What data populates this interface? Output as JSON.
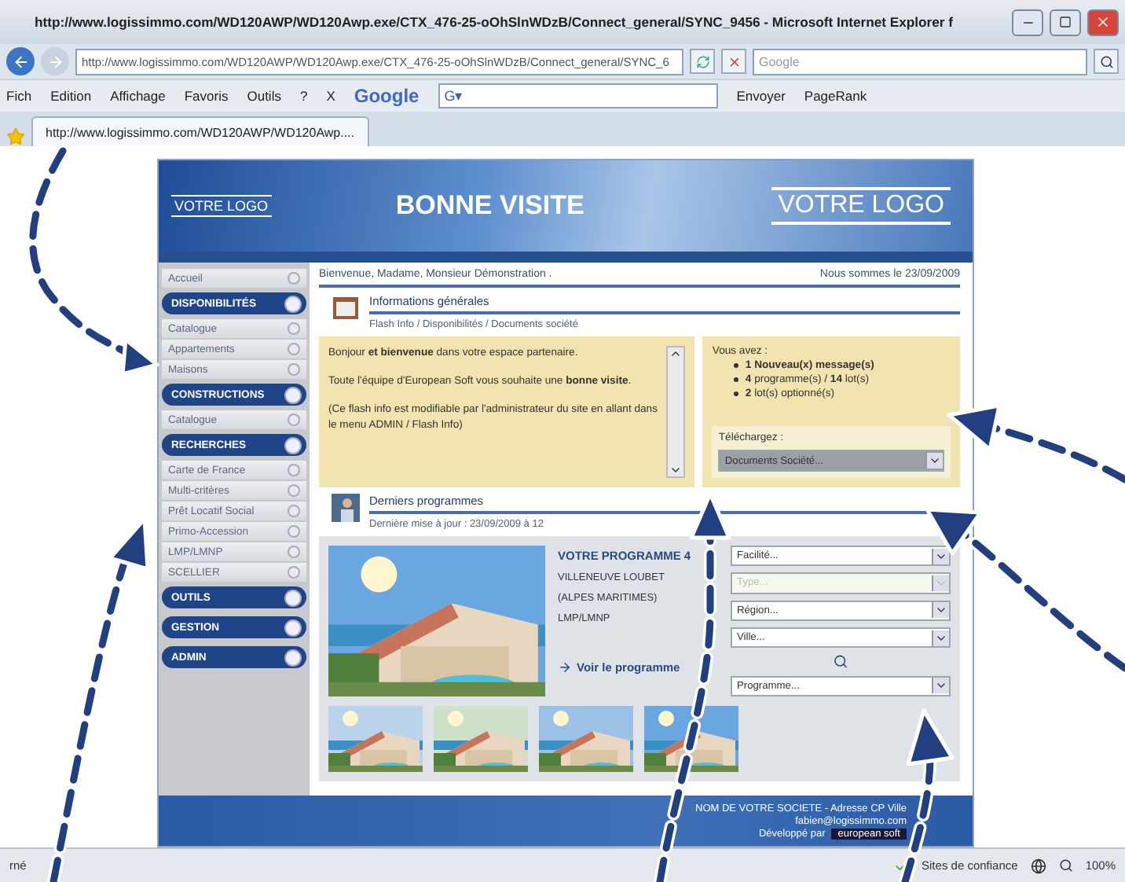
{
  "window": {
    "title": "http://www.logissimmo.com/WD120AWP/WD120Awp.exe/CTX_476-25-oOhSlnWDzB/Connect_general/SYNC_9456 - Microsoft Internet Explorer f"
  },
  "address_bar": {
    "value": "http://www.logissimmo.com/WD120AWP/WD120Awp.exe/CTX_476-25-oOhSlnWDzB/Connect_general/SYNC_6",
    "search_placeholder": "Google"
  },
  "menu": [
    "Fich",
    "Edition",
    "Affichage",
    "Favoris",
    "Outils",
    "?"
  ],
  "google_toolbar": {
    "close": "X",
    "logo": "Google",
    "field": "G▾",
    "send": "Envoyer",
    "pagerank": "PageRank"
  },
  "tabs": [
    {
      "label": "http://www.logissimmo.com/WD120AWP/WD120Awp....",
      "selected": true
    }
  ],
  "header": {
    "logo_left": "VOTRE LOGO",
    "title": "BONNE VISITE",
    "logo_right": "VOTRE LOGO"
  },
  "sidebar": [
    {
      "kind": "link",
      "label": "Accueil"
    },
    {
      "kind": "section",
      "label": "DISPONIBILITÉS"
    },
    {
      "kind": "link",
      "label": "Catalogue"
    },
    {
      "kind": "link",
      "label": "Appartements"
    },
    {
      "kind": "link",
      "label": "Maisons"
    },
    {
      "kind": "section",
      "label": "CONSTRUCTIONS"
    },
    {
      "kind": "link",
      "label": "Catalogue"
    },
    {
      "kind": "section",
      "label": "RECHERCHES"
    },
    {
      "kind": "link",
      "label": "Carte de France"
    },
    {
      "kind": "link",
      "label": "Multi-critères"
    },
    {
      "kind": "link",
      "label": "Prêt Locatif Social"
    },
    {
      "kind": "link",
      "label": "Primo-Accession"
    },
    {
      "kind": "link",
      "label": "LMP/LMNP"
    },
    {
      "kind": "link",
      "label": "SCELLIER"
    },
    {
      "kind": "section",
      "label": "OUTILS"
    },
    {
      "kind": "section",
      "label": "GESTION"
    },
    {
      "kind": "section",
      "label": "ADMIN"
    }
  ],
  "welcome": {
    "greeting": "Bienvenue, Madame, Monsieur Démonstration .",
    "date": "Nous sommes le 23/09/2009"
  },
  "info": {
    "title": "Informations générales",
    "subtitle": "Flash Info / Disponibilités / Documents société",
    "flash": [
      "Bonjour **et bienvenue** dans votre espace partenaire.",
      "Toute l'équipe d'European Soft vous souhaite une **bonne visite**.",
      "(Ce flash info est modifiable par l'administrateur du site en allant dans le menu ADMIN / Flash Info)"
    ],
    "summary_title": "Vous avez :",
    "summary": [
      "**1 Nouveau(x) message(s)**",
      "**4** programme(s) / **14** lot(s)",
      "**2** lot(s) optionné(s)"
    ],
    "download_label": "Téléchargez :",
    "download_select": "Documents Société..."
  },
  "programmes": {
    "title": "Derniers programmes",
    "subtitle": "Dernière mise à jour : 23/09/2009 à 12",
    "name": "VOTRE PROGRAMME 4",
    "city": "VILLENEUVE LOUBET",
    "region": "(ALPES MARITIMES)",
    "tax": "LMP/LMNP",
    "link": "Voir le programme",
    "filters": [
      {
        "value": "Facilité...",
        "disabled": false
      },
      {
        "value": "Type...",
        "disabled": true
      },
      {
        "value": "Région...",
        "disabled": false
      },
      {
        "value": "Ville...",
        "disabled": false
      },
      {
        "kind": "search"
      },
      {
        "value": "Programme...",
        "disabled": false
      }
    ]
  },
  "footer": {
    "company": "NOM DE VOTRE SOCIETE - Adresse CP Ville",
    "email": "fabien@logissimmo.com",
    "developed_by": "Développé par",
    "brand": "european soft"
  },
  "status_bar": {
    "text": "rné",
    "zone": "Sites de confiance",
    "zoom": "100%"
  }
}
